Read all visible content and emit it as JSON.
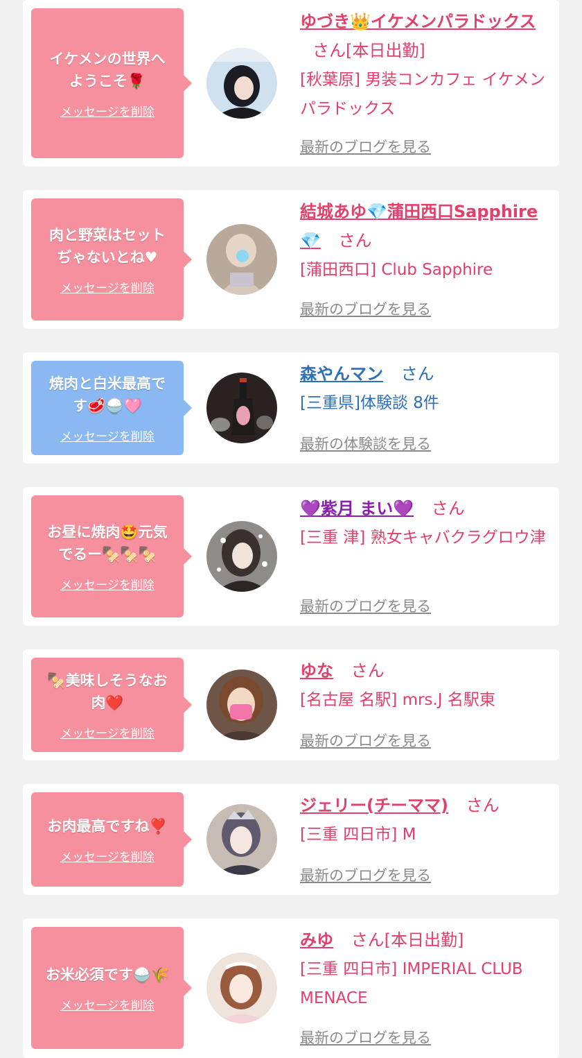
{
  "colors": {
    "pink_bubble": "#f7909e",
    "blue_bubble": "#89b8f2",
    "name_pink": "#e2406b",
    "name_blue": "#2e6fb6",
    "link_grey": "#8a8a8a"
  },
  "delete_label": "メッセージを削除",
  "san_label": "さん",
  "cards": [
    {
      "message": "イケメンの世界へ\nようこそ🌹",
      "name": "ゆづき👑イケメンパラドックス",
      "suffix": "[本日出勤]",
      "shop": "[秋葉原] 男装コンカフェ イケメンパラドックス",
      "link": "最新のブログを見る",
      "avatar_icon": "avatar-photo"
    },
    {
      "message": "肉と野菜はセット\nぢゃないとね♥",
      "name": "結城あゆ💎蒲田西口Sapphire💎",
      "suffix": "",
      "shop": "[蒲田西口] Club Sapphire",
      "link": "最新のブログを見る",
      "avatar_icon": "avatar-photo"
    },
    {
      "message": "焼肉と白米最高で\nす🥩🍚🩷",
      "name": "森やんマン",
      "suffix": "",
      "shop": "[三重県]体験談 8件",
      "link": "最新の体験談を見る",
      "avatar_icon": "avatar-photo"
    },
    {
      "message": "お昼に焼肉🤩元気\nでるー🍢🍢🍢",
      "name": "💜紫月 まい💜",
      "suffix": "",
      "shop": "[三重 津] 熟女キャバクラグロウ津",
      "link": "最新のブログを見る",
      "avatar_icon": "avatar-photo"
    },
    {
      "message": "🍢美味しそうなお\n肉❤️",
      "name": "ゆな",
      "suffix": "",
      "shop": "[名古屋 名駅] mrs.J 名駅東",
      "link": "最新のブログを見る",
      "avatar_icon": "avatar-photo"
    },
    {
      "message": "お肉最高ですね❣️",
      "name": "ジェリー(チーママ)",
      "suffix": "",
      "shop": "[三重 四日市] M",
      "link": "最新のブログを見る",
      "avatar_icon": "avatar-photo"
    },
    {
      "message": "お米必須です🍚🌾",
      "name": "みゆ",
      "suffix": "[本日出勤]",
      "shop": "[三重 四日市] IMPERIAL CLUB MENACE",
      "link": "最新のブログを見る",
      "avatar_icon": "avatar-photo"
    }
  ]
}
